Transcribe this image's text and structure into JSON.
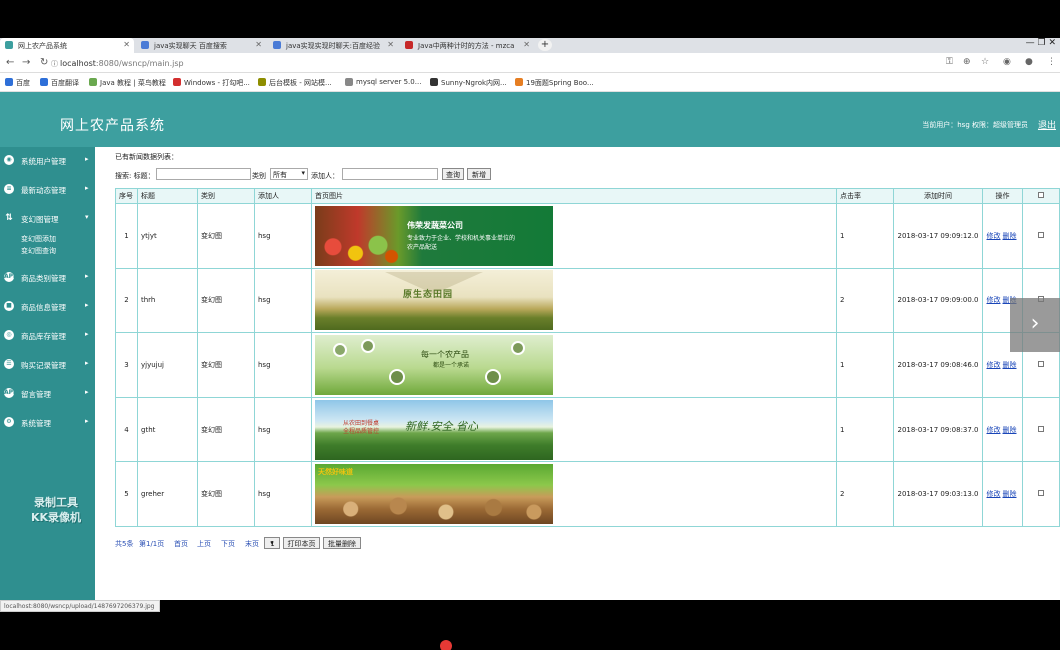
{
  "browser": {
    "tabs": [
      {
        "title": "网上农产品系统",
        "color": "#3d9f9f"
      },
      {
        "title": "java实现聊天 百度搜索",
        "color": "#4a7bd6"
      },
      {
        "title": "java实现实现时聊天:百度经验",
        "color": "#4a7bd6"
      },
      {
        "title": "Java中两种计时的方法 - mzca",
        "color": "#c62828"
      }
    ],
    "new_tab": "+",
    "window_controls": "—  ❐  ✕",
    "url_host": "localhost",
    "url_rest": ":8080/wsncp/main.jsp",
    "bookmarks": [
      {
        "label": "百度",
        "color": "#2e6fd8"
      },
      {
        "label": "百度翻译",
        "color": "#2e6fd8"
      },
      {
        "label": "Java 教程 | 菜鸟教程",
        "color": "#6aa84f"
      },
      {
        "label": "Windows - 打勾吧...",
        "color": "#d32f2f"
      },
      {
        "label": "后台模板 - 网站模...",
        "color": "#8e8e00"
      },
      {
        "label": "mysql server 5.0...",
        "color": "#888888"
      },
      {
        "label": "Sunny-Ngrok内网...",
        "color": "#333333"
      },
      {
        "label": "19面题Spring Boo...",
        "color": "#e67e22"
      }
    ]
  },
  "app": {
    "title": "网上农产品系统",
    "user_info": "当前用户：hsg  权限：超级管理员",
    "logout": "退出"
  },
  "sidebar": {
    "items": [
      {
        "label": "系统用户管理",
        "icon": "user-icon"
      },
      {
        "label": "最新动态管理",
        "icon": "news-icon"
      },
      {
        "label": "变幻图管理",
        "icon": "slideshow-icon",
        "expanded": true,
        "children": [
          "变幻图添加",
          "变幻图查询"
        ]
      },
      {
        "label": "商品类别管理",
        "icon": "category-icon"
      },
      {
        "label": "商品信息管理",
        "icon": "product-icon"
      },
      {
        "label": "商品库存管理",
        "icon": "stock-icon"
      },
      {
        "label": "购买记录管理",
        "icon": "purchase-icon"
      },
      {
        "label": "留言管理",
        "icon": "message-icon"
      },
      {
        "label": "系统管理",
        "icon": "settings-icon"
      }
    ],
    "watermark_line1": "录制工具",
    "watermark_line2": "KK录像机"
  },
  "main": {
    "list_title": "已有新闻数据列表：",
    "search": {
      "label_title": "搜索: 标题：",
      "title_value": "",
      "label_type": "类别",
      "type_value": "所有",
      "label_adder": "添加人：",
      "adder_value": "",
      "search_btn": "查询",
      "add_btn": "新增"
    },
    "columns": [
      "序号",
      "标题",
      "类别",
      "添加人",
      "首页图片",
      "点击率",
      "添加时间",
      "操作"
    ],
    "rows": [
      {
        "no": "1",
        "title": "ytjyt",
        "type": "变幻图",
        "adder": "hsg",
        "clicks": "1",
        "time": "2018-03-17 09:09:12.0",
        "banner": "banner-1"
      },
      {
        "no": "2",
        "title": "thrh",
        "type": "变幻图",
        "adder": "hsg",
        "clicks": "2",
        "time": "2018-03-17 09:09:00.0",
        "banner": "banner-2"
      },
      {
        "no": "3",
        "title": "yjyujuj",
        "type": "变幻图",
        "adder": "hsg",
        "clicks": "1",
        "time": "2018-03-17 09:08:46.0",
        "banner": "banner-3"
      },
      {
        "no": "4",
        "title": "gtht",
        "type": "变幻图",
        "adder": "hsg",
        "clicks": "1",
        "time": "2018-03-17 09:08:37.0",
        "banner": "banner-4"
      },
      {
        "no": "5",
        "title": "greher",
        "type": "变幻图",
        "adder": "hsg",
        "clicks": "2",
        "time": "2018-03-17 09:03:13.0",
        "banner": "banner-5"
      }
    ],
    "action_edit": "修改",
    "action_delete": "删除",
    "banner_texts": {
      "b1_company": "伟荣发蔬菜公司",
      "b1_slogan1": "专业致力于企业、学校和机关事业单位的",
      "b1_slogan2": "农产品配送",
      "b2_title": "原生态田园",
      "b3_line1": "每一个农产品",
      "b3_line2": "都是一个承诺",
      "b4_red": "从农田到餐桌",
      "b4_red2": "全程品质管控",
      "b4_big": "新鲜.安全.省心",
      "b5_text": "天然好味道"
    },
    "pager": {
      "total": "共5条",
      "page": "第1/1页",
      "first": "首页",
      "prev": "上页",
      "next": "下页",
      "last": "末页",
      "page_select": "1",
      "print_btn": "打印本页",
      "batch_delete_btn": "批量删除"
    }
  },
  "statusbar": "localhost:8080/wsncp/upload/1487697206379.jpg",
  "colors": {
    "header": "#3d9f9f",
    "sidebar": "#2f8f8f",
    "table_border": "#8fd6d6",
    "link": "#1a46b8"
  }
}
